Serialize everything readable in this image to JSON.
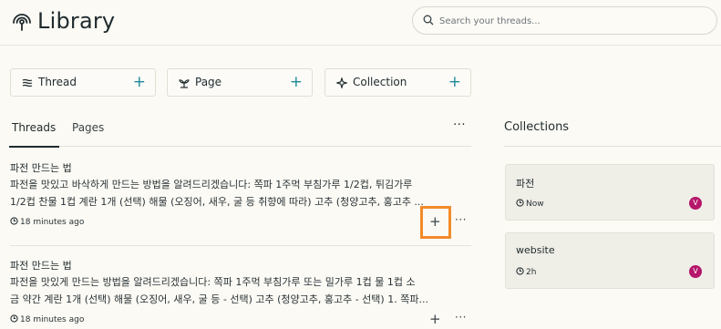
{
  "header": {
    "title": "Library",
    "search_placeholder": "Search your threads..."
  },
  "quick_actions": [
    {
      "label": "Thread",
      "icon": "waves-icon"
    },
    {
      "label": "Page",
      "icon": "sprout-icon"
    },
    {
      "label": "Collection",
      "icon": "sparkle-icon"
    }
  ],
  "tabs": {
    "threads": "Threads",
    "pages": "Pages"
  },
  "threads": [
    {
      "title": "파전 만드는 법",
      "snippet_1": "파전을 맛있고 바삭하게 만드는 방법을 알려드리겠습니다: 쪽파 1주먹 부침가루 1/2컵, 튀김가루",
      "snippet_2": "1/2컵 찬물 1컵 계란 1개 (선택) 해물 (오징어, 새우, 굴 등 취향에 따라) 고추 (청양고추, 홍고추 ...",
      "time": "18 minutes ago"
    },
    {
      "title": "파전 만드는 법",
      "snippet_1": "파전을 맛있게 만드는 방법을 알려드리겠습니다: 쪽파 1주먹 부침가루 또는 밀가루 1컵 물 1컵 소",
      "snippet_2": "금 약간 계란 1개 (선택) 해물 (오징어, 새우, 굴 등 - 선택) 고추 (청양고추, 홍고추 - 선택) 1. 쪽파...",
      "time": "18 minutes ago"
    }
  ],
  "collections": {
    "title": "Collections",
    "items": [
      {
        "name": "파전",
        "time": "Now",
        "avatar": "V"
      },
      {
        "name": "website",
        "time": "2h",
        "avatar": "V"
      }
    ]
  },
  "colors": {
    "accent": "#1e8a9a",
    "highlight": "#f28b2a",
    "avatar": "#b5176a",
    "background": "#fbfaf4"
  }
}
